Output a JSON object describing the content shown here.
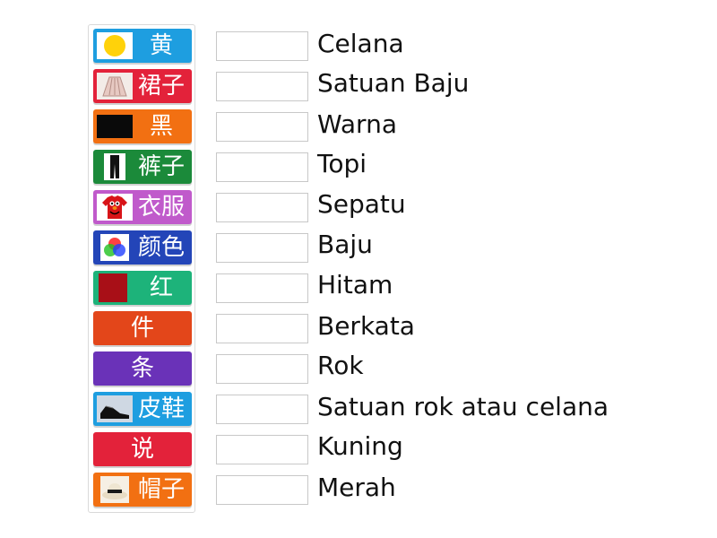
{
  "tiles": [
    {
      "label": "黄",
      "color": "#1e9ee0",
      "icon": "yellow-circle-icon"
    },
    {
      "label": "裙子",
      "color": "#e3223a",
      "icon": "skirt-icon"
    },
    {
      "label": "黑",
      "color": "#f27012",
      "icon": "black-swatch-icon"
    },
    {
      "label": "裤子",
      "color": "#1b8a3a",
      "icon": "pants-icon"
    },
    {
      "label": "衣服",
      "color": "#c05acb",
      "icon": "tshirt-icon"
    },
    {
      "label": "颜色",
      "color": "#2345b8",
      "icon": "rgb-color-icon"
    },
    {
      "label": "红",
      "color": "#1db37a",
      "icon": "red-swatch-icon"
    },
    {
      "label": "件",
      "color": "#e3461a",
      "icon": ""
    },
    {
      "label": "条",
      "color": "#6a32b8",
      "icon": ""
    },
    {
      "label": "皮鞋",
      "color": "#1e9ee0",
      "icon": "shoe-icon"
    },
    {
      "label": "说",
      "color": "#e3223a",
      "icon": ""
    },
    {
      "label": "帽子",
      "color": "#f27012",
      "icon": "hat-icon"
    }
  ],
  "targets": [
    {
      "label": "Celana"
    },
    {
      "label": "Satuan Baju"
    },
    {
      "label": "Warna"
    },
    {
      "label": "Topi"
    },
    {
      "label": "Sepatu"
    },
    {
      "label": "Baju"
    },
    {
      "label": "Hitam"
    },
    {
      "label": "Berkata"
    },
    {
      "label": "Rok"
    },
    {
      "label": "Satuan rok atau celana"
    },
    {
      "label": "Kuning"
    },
    {
      "label": "Merah"
    }
  ]
}
